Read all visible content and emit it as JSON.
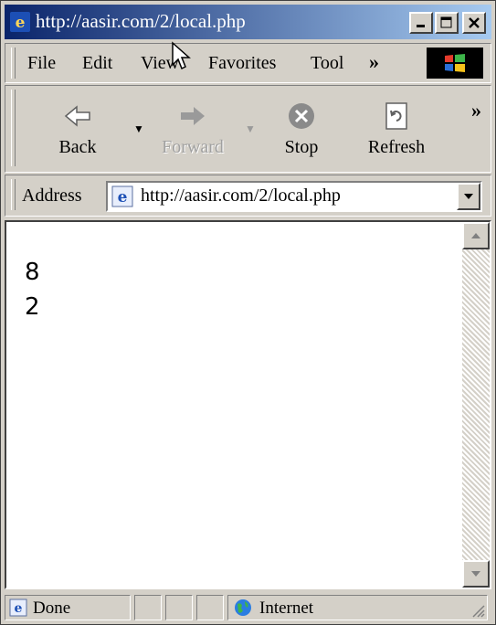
{
  "window": {
    "title": "http://aasir.com/2/local.php"
  },
  "menu": {
    "items": [
      "File",
      "Edit",
      "View",
      "Favorites",
      "Tool"
    ],
    "overflow": "»"
  },
  "toolbar": {
    "back": "Back",
    "forward": "Forward",
    "stop": "Stop",
    "refresh": "Refresh",
    "overflow": "»"
  },
  "address": {
    "label": "Address",
    "url": "http://aasir.com/2/local.php"
  },
  "content": {
    "lines": [
      "8",
      "2"
    ]
  },
  "status": {
    "text": "Done",
    "zone": "Internet"
  },
  "colors": {
    "title_start": "#0a246a",
    "title_end": "#a6caf0",
    "chrome": "#d4d0c8"
  }
}
